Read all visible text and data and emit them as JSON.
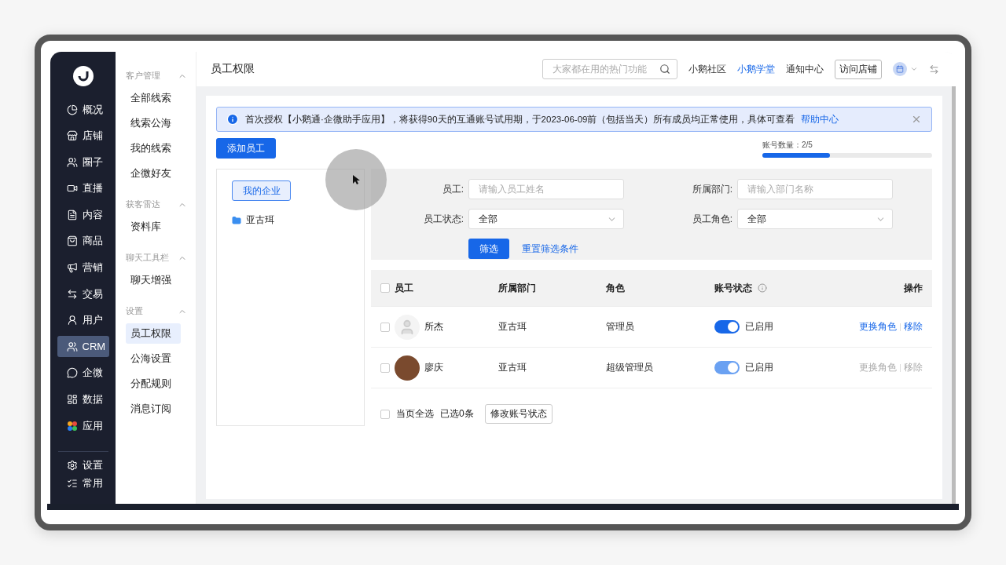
{
  "nav": {
    "items": [
      {
        "label": "概况",
        "selected": false
      },
      {
        "label": "店铺",
        "selected": false
      },
      {
        "label": "圈子",
        "selected": false
      },
      {
        "label": "直播",
        "selected": false
      },
      {
        "label": "内容",
        "selected": false
      },
      {
        "label": "商品",
        "selected": false
      },
      {
        "label": "营销",
        "selected": false
      },
      {
        "label": "交易",
        "selected": false
      },
      {
        "label": "用户",
        "selected": false
      },
      {
        "label": "CRM",
        "selected": true
      },
      {
        "label": "企微",
        "selected": false
      },
      {
        "label": "数据",
        "selected": false
      },
      {
        "label": "应用",
        "selected": false
      }
    ],
    "bottom": [
      {
        "label": "设置"
      },
      {
        "label": "常用"
      }
    ]
  },
  "subnav": [
    {
      "title": "客户管理",
      "expanded": true,
      "items": [
        {
          "label": "全部线索",
          "selected": false
        },
        {
          "label": "线索公海",
          "selected": false
        },
        {
          "label": "我的线索",
          "selected": false
        },
        {
          "label": "企微好友",
          "selected": false
        }
      ]
    },
    {
      "title": "获客雷达",
      "expanded": true,
      "items": [
        {
          "label": "资料库",
          "selected": false
        }
      ]
    },
    {
      "title": "聊天工具栏",
      "expanded": true,
      "items": [
        {
          "label": "聊天增强",
          "selected": false
        }
      ]
    },
    {
      "title": "设置",
      "expanded": true,
      "items": [
        {
          "label": "员工权限",
          "selected": true
        },
        {
          "label": "公海设置",
          "selected": false
        },
        {
          "label": "分配规则",
          "selected": false
        },
        {
          "label": "消息订阅",
          "selected": false
        }
      ]
    }
  ],
  "header": {
    "title": "员工权限",
    "search": {
      "placeholder": "大家都在用的热门功能"
    },
    "links": [
      {
        "label": "小鹅社区",
        "selected": false
      },
      {
        "label": "小鹅学堂",
        "selected": true
      },
      {
        "label": "通知中心",
        "selected": false
      }
    ],
    "visit_button": "访问店铺"
  },
  "notice": {
    "text": "首次授权【小鹅通·企微助手应用】，将获得90天的互通账号试用期，于2023-06-09前（包括当天）所有成员均正常使用，具体可查看",
    "link": "帮助中心"
  },
  "add_button": "添加员工",
  "quota": {
    "label": "账号数量：2/5",
    "level": 0.4
  },
  "org": {
    "root": "我的企业",
    "items": [
      {
        "label": "亚古珥"
      }
    ]
  },
  "filters": [
    {
      "label": "员工:",
      "kind": "input",
      "placeholder": "请输入员工姓名"
    },
    {
      "label": "所属部门:",
      "kind": "input",
      "placeholder": "请输入部门名称"
    },
    {
      "label": "员工状态:",
      "kind": "select",
      "value": "全部"
    },
    {
      "label": "员工角色:",
      "kind": "select",
      "value": "全部"
    }
  ],
  "filter_button": "筛选",
  "reset_link": "重置筛选条件",
  "table": {
    "all_checked": false,
    "columns": [
      "员工",
      "所属部门",
      "角色",
      "账号状态",
      "操作"
    ],
    "rows": [
      {
        "checked": false,
        "name": "所杰",
        "dept": "亚古珥",
        "role": "管理员",
        "on": true,
        "disabled": false,
        "status": "已启用",
        "actions": [
          "更换角色",
          "移除"
        ]
      },
      {
        "checked": false,
        "name": "廖庆",
        "dept": "亚古珥",
        "role": "超级管理员",
        "on": true,
        "disabled": true,
        "status": "已启用",
        "actions": [
          "更换角色",
          "移除"
        ]
      }
    ]
  },
  "footer": {
    "select_all": "当页全选",
    "select_all_checked": false,
    "selected_count": "已选0条",
    "button": "修改账号状态"
  }
}
